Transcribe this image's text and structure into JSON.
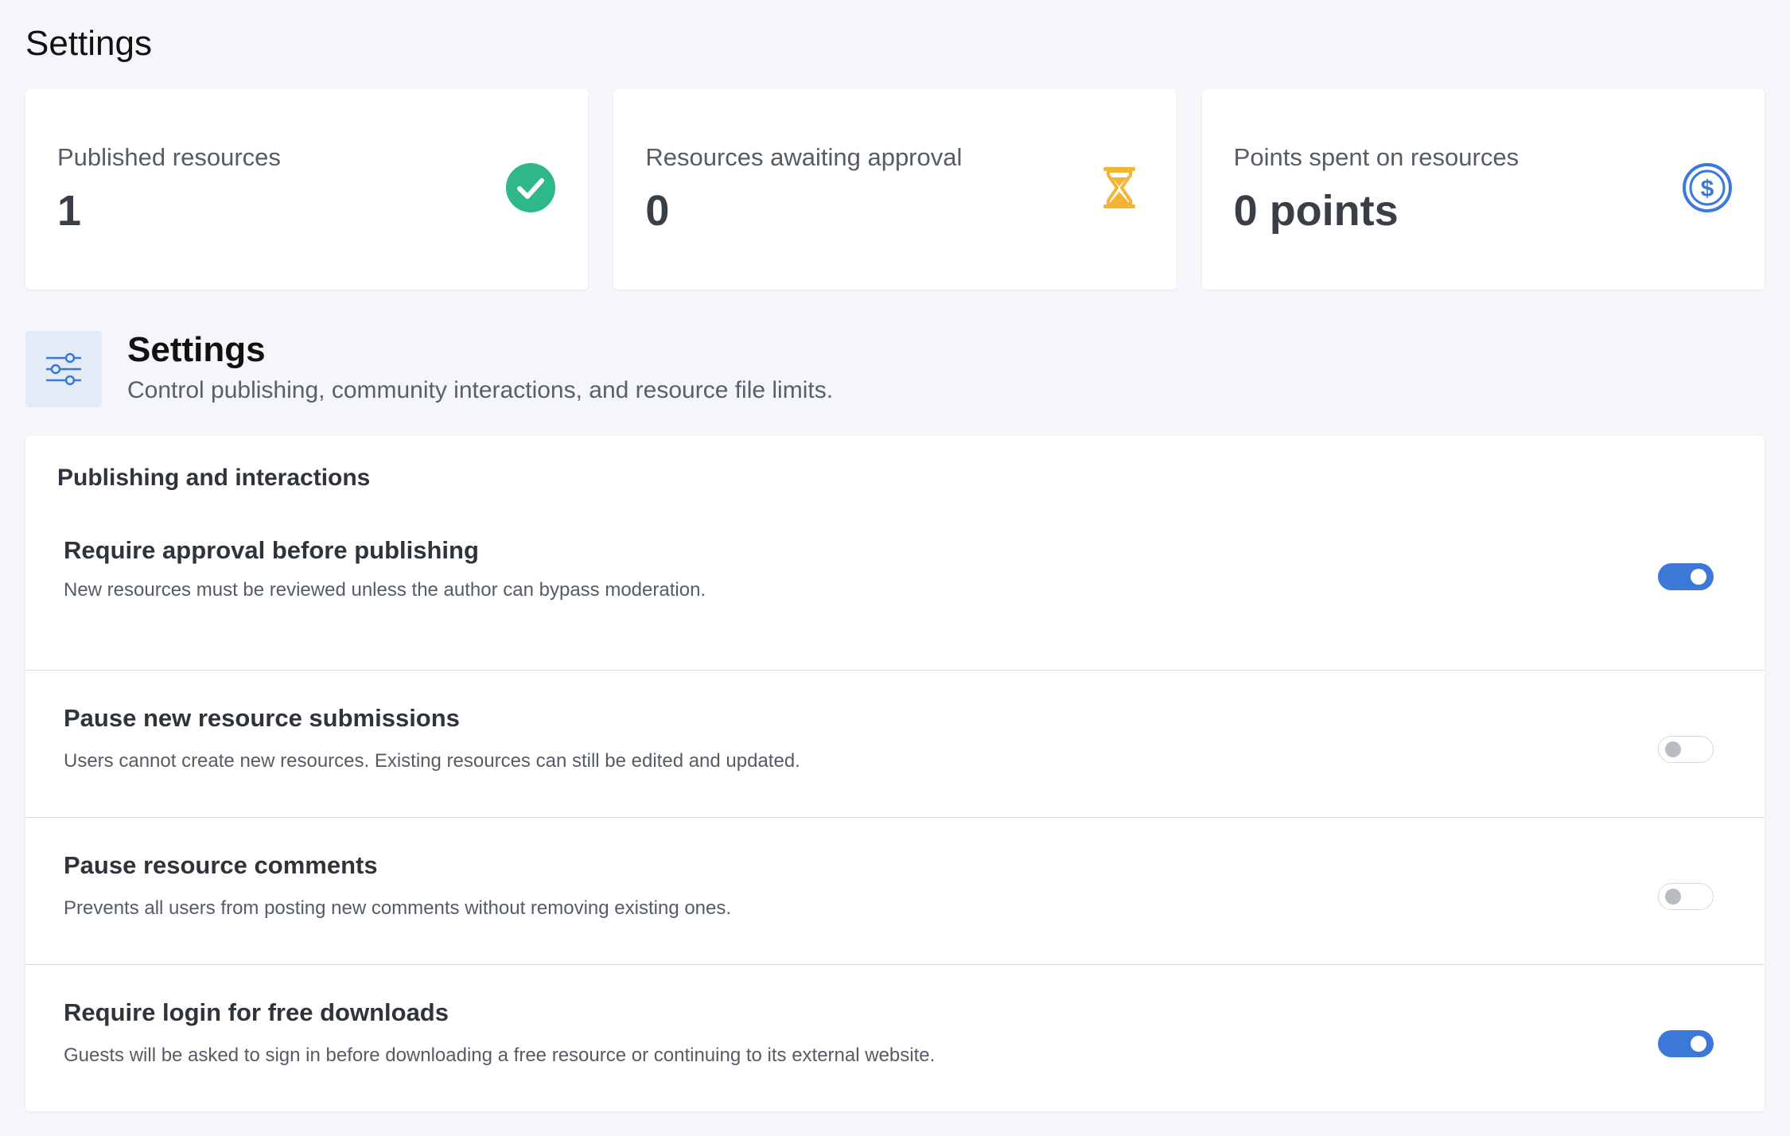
{
  "page": {
    "title": "Settings"
  },
  "stats": [
    {
      "label": "Published resources",
      "value": "1",
      "icon": "check-circle-icon",
      "color": "#2eb88a"
    },
    {
      "label": "Resources awaiting approval",
      "value": "0",
      "icon": "hourglass-icon",
      "color": "#f5b533"
    },
    {
      "label": "Points spent on resources",
      "value": "0 points",
      "icon": "dollar-circle-icon",
      "color": "#3b78d8"
    }
  ],
  "section": {
    "title": "Settings",
    "description": "Control publishing, community interactions, and resource file limits.",
    "icon": "sliders-icon"
  },
  "panel": {
    "heading": "Publishing and interactions",
    "settings": [
      {
        "title": "Require approval before publishing",
        "description": "New resources must be reviewed unless the author can bypass moderation.",
        "enabled": true
      },
      {
        "title": "Pause new resource submissions",
        "description": "Users cannot create new resources. Existing resources can still be edited and updated.",
        "enabled": false
      },
      {
        "title": "Pause resource comments",
        "description": "Prevents all users from posting new comments without removing existing ones.",
        "enabled": false
      },
      {
        "title": "Require login for free downloads",
        "description": "Guests will be asked to sign in before downloading a free resource or continuing to its external website.",
        "enabled": true
      }
    ]
  },
  "colors": {
    "accent": "#3b78d8",
    "background": "#f4f6fa"
  }
}
